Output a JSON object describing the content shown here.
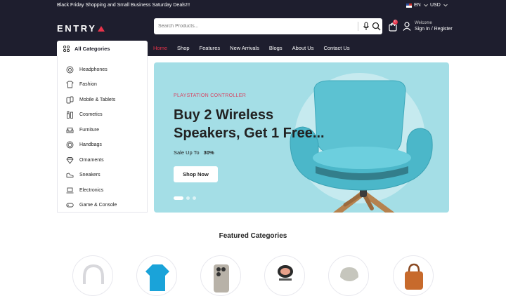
{
  "topbar": {
    "promo": "Black Friday Shopping and Small Business Saturday Deals!!!",
    "language": "EN",
    "currency": "USD"
  },
  "header": {
    "logo": "ENTRY",
    "search_placeholder": "Search Products...",
    "cart_count": "0",
    "welcome": "Welcome",
    "signin": "Sign In / Register"
  },
  "nav": {
    "all_categories": "All Categories",
    "links": [
      "Home",
      "Shop",
      "Features",
      "New Arrivals",
      "Blogs",
      "About Us",
      "Contact Us"
    ],
    "active": "Home"
  },
  "sidebar": {
    "items": [
      {
        "label": "Headphones",
        "icon": "headphones-icon"
      },
      {
        "label": "Fashion",
        "icon": "tshirt-icon"
      },
      {
        "label": "Mobile & Tablets",
        "icon": "mobile-icon"
      },
      {
        "label": "Cosmetics",
        "icon": "cosmetics-icon"
      },
      {
        "label": "Furniture",
        "icon": "sofa-icon"
      },
      {
        "label": "Handbags",
        "icon": "handbag-icon"
      },
      {
        "label": "Ornaments",
        "icon": "diamond-icon"
      },
      {
        "label": "Sneakers",
        "icon": "sneaker-icon"
      },
      {
        "label": "Electronics",
        "icon": "laptop-icon"
      },
      {
        "label": "Game & Console",
        "icon": "gamepad-icon"
      }
    ]
  },
  "hero": {
    "tagline": "PLAYSTATION CONTROLLER",
    "headline": "Buy 2 Wireless Speakers, Get 1 Free...",
    "sale_label": "Sale Up To",
    "sale_value": "30%",
    "button": "Shop Now"
  },
  "featured": {
    "title": "Featured Categories"
  },
  "colors": {
    "dark": "#1e1e2e",
    "accent": "#e8334a",
    "hero_bg": "#a4dee6"
  }
}
